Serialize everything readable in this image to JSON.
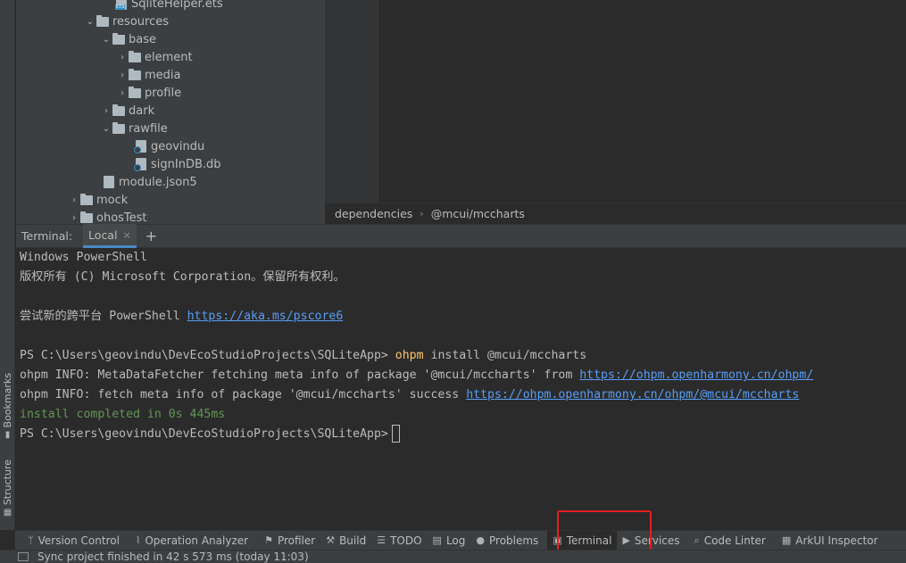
{
  "sidebar_tabs": {
    "bookmarks": "Bookmarks",
    "structure": "Structure"
  },
  "tree": [
    {
      "indent": 3,
      "type": "file",
      "icon": "ets",
      "name": "SqliteHelper.ets",
      "arrow": ""
    },
    {
      "indent": 2,
      "type": "folder",
      "name": "resources",
      "arrow": "⌄"
    },
    {
      "indent": 3,
      "type": "folder",
      "name": "base",
      "arrow": "⌄"
    },
    {
      "indent": 4,
      "type": "folder",
      "name": "element",
      "arrow": "›"
    },
    {
      "indent": 4,
      "type": "folder",
      "name": "media",
      "arrow": "›"
    },
    {
      "indent": 4,
      "type": "folder",
      "name": "profile",
      "arrow": "›"
    },
    {
      "indent": 3,
      "type": "folder",
      "name": "dark",
      "arrow": "›"
    },
    {
      "indent": 3,
      "type": "folder",
      "name": "rawfile",
      "arrow": "⌄"
    },
    {
      "indent": 4,
      "type": "file",
      "icon": "link",
      "name": "geovindu",
      "arrow": ""
    },
    {
      "indent": 4,
      "type": "file",
      "icon": "link",
      "name": "signInDB.db",
      "arrow": ""
    },
    {
      "indent": 2,
      "type": "file",
      "icon": "json",
      "name": "module.json5",
      "arrow": ""
    },
    {
      "indent": 1,
      "type": "folder",
      "name": "mock",
      "arrow": "›"
    },
    {
      "indent": 1,
      "type": "folder",
      "name": "ohosTest",
      "arrow": "›"
    }
  ],
  "breadcrumb": {
    "first": "dependencies",
    "second": "@mcui/mccharts",
    "sep": "›"
  },
  "terminal": {
    "label": "Terminal:",
    "tab": "Local",
    "close": "×",
    "add": "+",
    "lines": {
      "l1": "Windows PowerShell",
      "l2": "版权所有 (C) Microsoft Corporation。保留所有权利。",
      "l3_text": "尝试新的跨平台 PowerShell ",
      "l3_link": "https://aka.ms/pscore6",
      "l4_prompt": "PS C:\\Users\\geovindu\\DevEcoStudioProjects\\SQLiteApp> ",
      "l4_cmd": "ohpm",
      "l4_args": " install @mcui/mccharts",
      "l5_text": "ohpm INFO: MetaDataFetcher fetching meta info of package '@mcui/mccharts' from ",
      "l5_link": "https://ohpm.openharmony.cn/ohpm/",
      "l6_text": "ohpm INFO: fetch meta info of package '@mcui/mccharts' success ",
      "l6_link": "https://ohpm.openharmony.cn/ohpm/@mcui/mccharts",
      "l7": "install completed in 0s 445ms",
      "l8_prompt": "PS C:\\Users\\geovindu\\DevEcoStudioProjects\\SQLiteApp>"
    }
  },
  "toolbar": {
    "version_control": "Version Control",
    "operation_analyzer": "Operation Analyzer",
    "profiler": "Profiler",
    "build": "Build",
    "todo": "TODO",
    "log": "Log",
    "problems": "Problems",
    "terminal": "Terminal",
    "services": "Services",
    "code_linter": "Code Linter",
    "arkui_inspector": "ArkUI Inspector"
  },
  "status": {
    "message": "Sync project finished in 42 s 573 ms (today 11:03)"
  },
  "colors": {
    "accent": "#4a88c7",
    "highlight": "#e81e1e",
    "link": "#589df6",
    "success": "#629755",
    "command": "#ffc66d"
  }
}
